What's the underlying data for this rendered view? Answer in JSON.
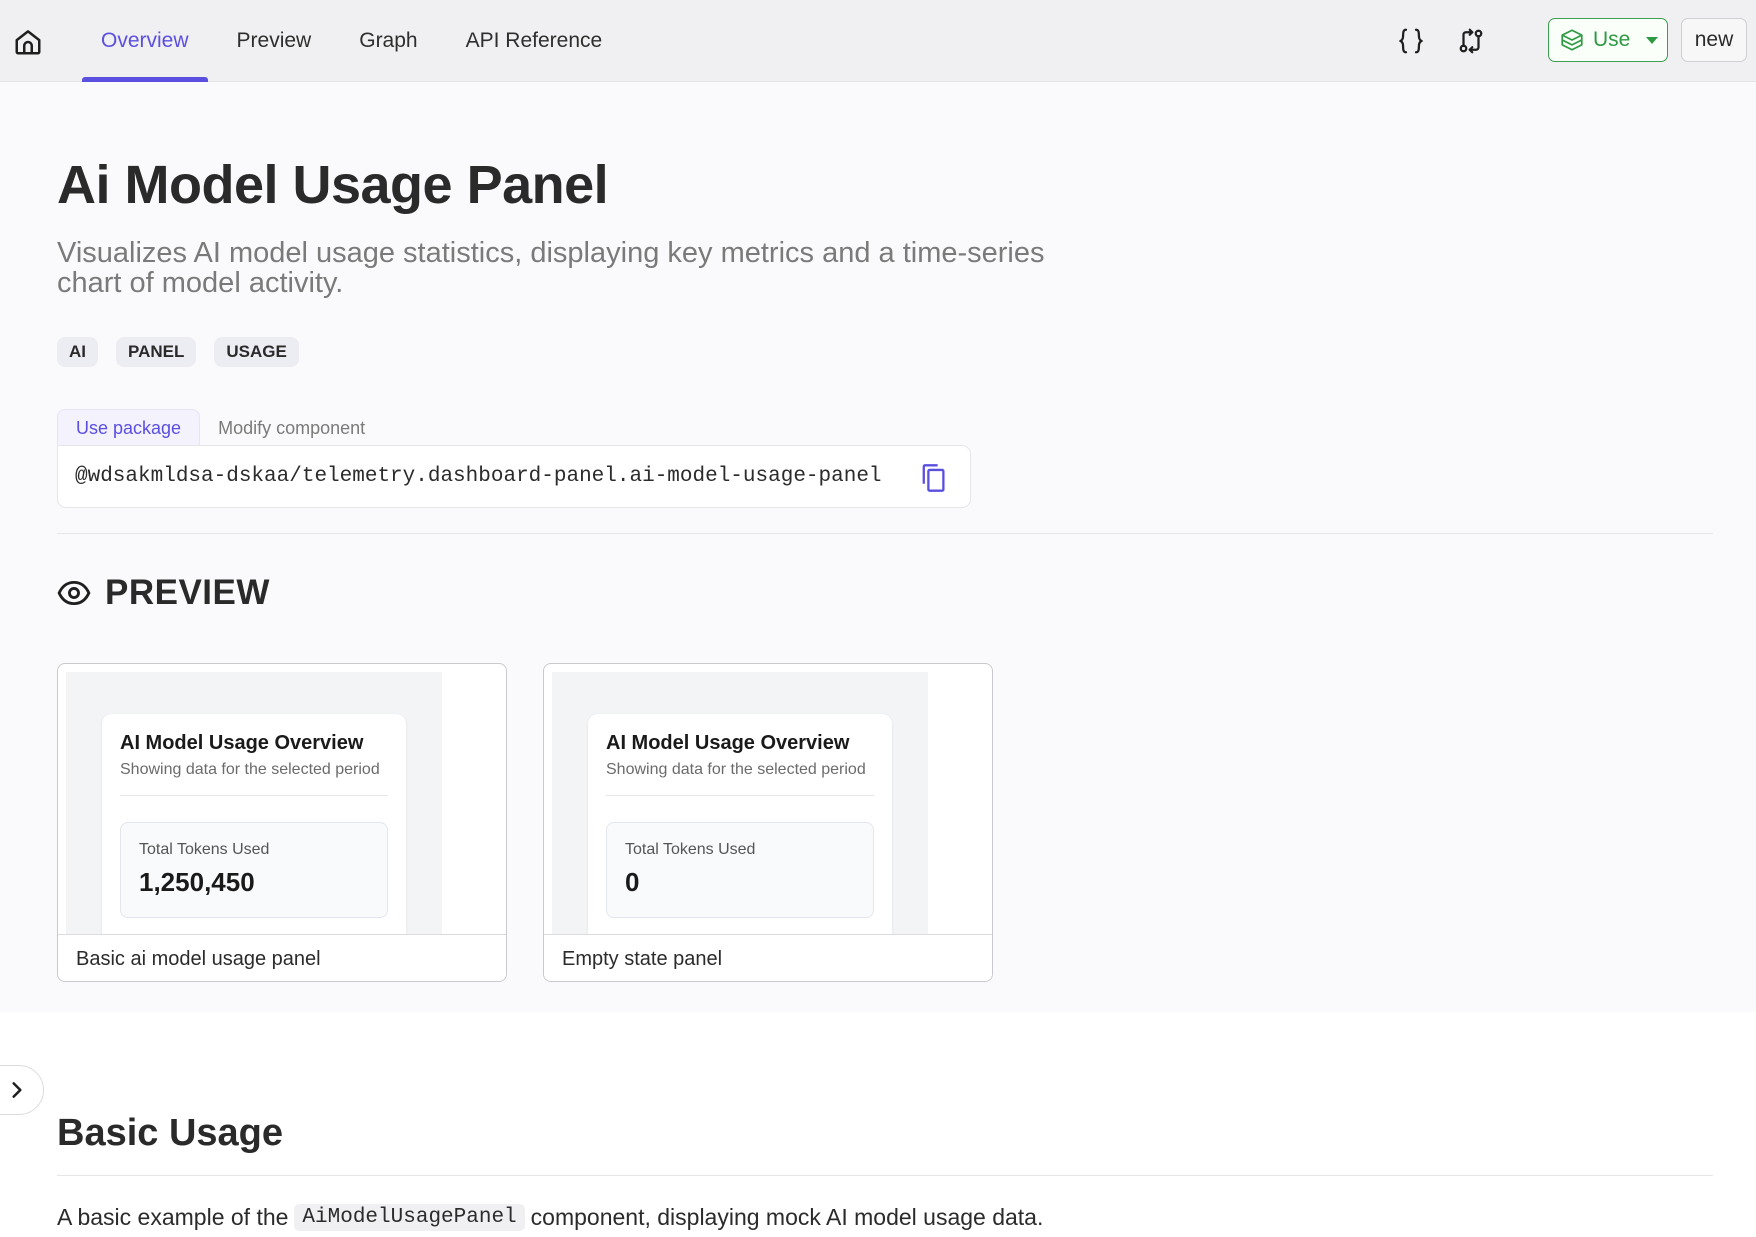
{
  "nav": {
    "tabs": [
      {
        "label": "Overview",
        "active": true
      },
      {
        "label": "Preview",
        "active": false
      },
      {
        "label": "Graph",
        "active": false
      },
      {
        "label": "API Reference",
        "active": false
      }
    ],
    "use_label": "Use",
    "new_label": "new",
    "icons": [
      "home-icon",
      "code-braces-icon",
      "compare-icon",
      "package-icon",
      "chevron-down-icon"
    ]
  },
  "header": {
    "title": "Ai Model Usage Panel",
    "description": "Visualizes AI model usage statistics, displaying key metrics and a time-series chart of model activity.",
    "tags": [
      "AI",
      "PANEL",
      "USAGE"
    ]
  },
  "package": {
    "tabs": [
      {
        "label": "Use package",
        "active": true
      },
      {
        "label": "Modify component",
        "active": false
      }
    ],
    "command": "@wdsakmldsa-dskaa/telemetry.dashboard-panel.ai-model-usage-panel"
  },
  "preview": {
    "heading": "PREVIEW",
    "cards": [
      {
        "panel_title": "AI Model Usage Overview",
        "panel_subtitle": "Showing data for the selected period",
        "metric_label": "Total Tokens Used",
        "metric_value": "1,250,450",
        "caption": "Basic ai model usage panel"
      },
      {
        "panel_title": "AI Model Usage Overview",
        "panel_subtitle": "Showing data for the selected period",
        "metric_label": "Total Tokens Used",
        "metric_value": "0",
        "caption": "Empty state panel"
      }
    ]
  },
  "basic_usage": {
    "title": "Basic Usage",
    "text_before": "A basic example of the",
    "code": "AiModelUsagePanel",
    "text_after": "component, displaying mock AI model usage data."
  },
  "colors": {
    "accent": "#5b4fe0",
    "use_green": "#3aa14c",
    "topbar_bg": "#f0f0f2"
  }
}
